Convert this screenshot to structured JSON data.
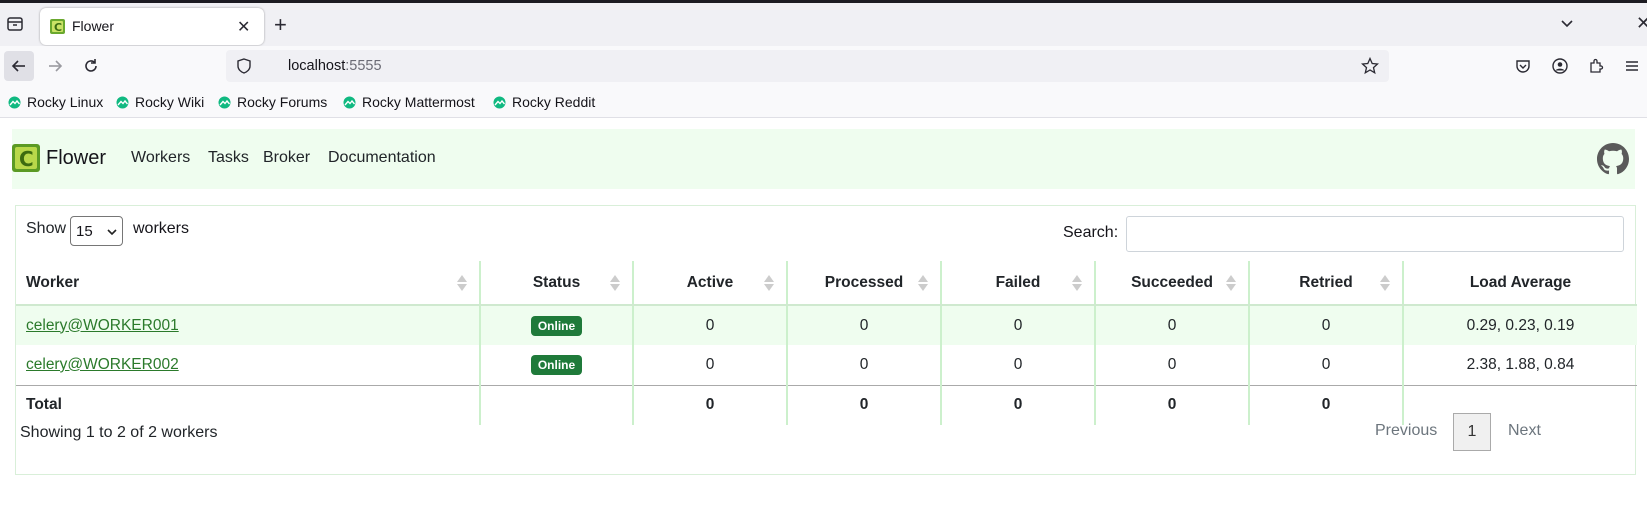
{
  "browser": {
    "tab_title": "Flower",
    "url_host": "localhost",
    "url_port": ":5555",
    "bookmarks": [
      "Rocky Linux",
      "Rocky Wiki",
      "Rocky Forums",
      "Rocky Mattermost",
      "Rocky Reddit"
    ]
  },
  "app": {
    "brand": "Flower",
    "nav": [
      "Workers",
      "Tasks",
      "Broker",
      "Documentation"
    ]
  },
  "controls": {
    "show_label": "Show",
    "page_size": "15",
    "page_size_suffix": "workers",
    "search_label": "Search:",
    "search_value": ""
  },
  "table": {
    "headers": [
      "Worker",
      "Status",
      "Active",
      "Processed",
      "Failed",
      "Succeeded",
      "Retried",
      "Load Average"
    ],
    "rows": [
      {
        "worker": "celery@WORKER001",
        "status": "Online",
        "active": "0",
        "processed": "0",
        "failed": "0",
        "succeeded": "0",
        "retried": "0",
        "load": "0.29, 0.23, 0.19"
      },
      {
        "worker": "celery@WORKER002",
        "status": "Online",
        "active": "0",
        "processed": "0",
        "failed": "0",
        "succeeded": "0",
        "retried": "0",
        "load": "2.38, 1.88, 0.84"
      }
    ],
    "total": {
      "label": "Total",
      "active": "0",
      "processed": "0",
      "failed": "0",
      "succeeded": "0",
      "retried": "0"
    }
  },
  "footer": {
    "info": "Showing 1 to 2 of 2 workers",
    "previous": "Previous",
    "current_page": "1",
    "next": "Next"
  },
  "colors": {
    "accent_green": "#1f7a3a",
    "row_stripe": "#effdef"
  }
}
